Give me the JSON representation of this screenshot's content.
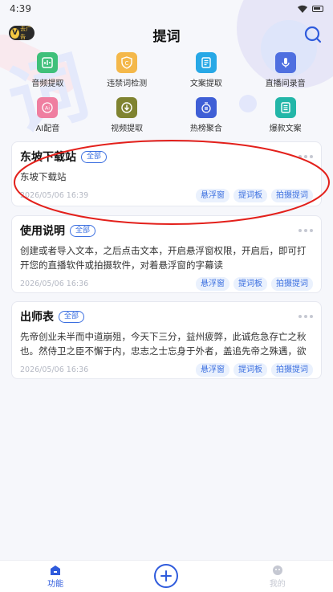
{
  "status_bar": {
    "time": "4:39"
  },
  "header": {
    "title": "提词",
    "logo_text": "去广告"
  },
  "tools": [
    {
      "label": "音频提取",
      "icon": "audio-extract-icon",
      "color": "#3fc07a"
    },
    {
      "label": "违禁词检测",
      "icon": "banned-word-check-icon",
      "color": "#f4b84a"
    },
    {
      "label": "文案提取",
      "icon": "copy-extract-icon",
      "color": "#27a8e6"
    },
    {
      "label": "直播间录音",
      "icon": "live-record-icon",
      "color": "#4f6fe0"
    },
    {
      "label": "AI配音",
      "icon": "ai-voice-icon",
      "color": "#ef7ea0"
    },
    {
      "label": "视频提取",
      "icon": "video-extract-icon",
      "color": "#7f8330"
    },
    {
      "label": "热榜聚合",
      "icon": "hot-list-icon",
      "color": "#3f5fd6"
    },
    {
      "label": "爆款文案",
      "icon": "hit-copy-icon",
      "color": "#23b6a8"
    }
  ],
  "cards": [
    {
      "title": "东坡下载站",
      "tag": "全部",
      "body": "东坡下载站",
      "date": "2026/05/06 16:39",
      "actions": [
        "悬浮窗",
        "提词板",
        "拍摄提词"
      ]
    },
    {
      "title": "使用说明",
      "tag": "全部",
      "body": "创建或者导入文本，之后点击文本，开启悬浮窗权限，开启后，即可打开您的直播软件或拍摄软件，对着悬浮窗的字幕读",
      "date": "2026/05/06 16:36",
      "actions": [
        "悬浮窗",
        "提词板",
        "拍摄提词"
      ]
    },
    {
      "title": "出师表",
      "tag": "全部",
      "body": "先帝创业未半而中道崩殂，今天下三分，益州疲弊，此诚危急存亡之秋也。然侍卫之臣不懈于内，忠志之士忘身于外者，盖追先帝之殊遇，欲报之于陛下也。",
      "date": "2026/05/06 16:36",
      "actions": [
        "悬浮窗",
        "提词板",
        "拍摄提词"
      ]
    }
  ],
  "tabbar": {
    "function_label": "功能",
    "mine_label": "我的",
    "active_color": "#2f5bdc",
    "inactive_color": "#c5c8d2"
  }
}
